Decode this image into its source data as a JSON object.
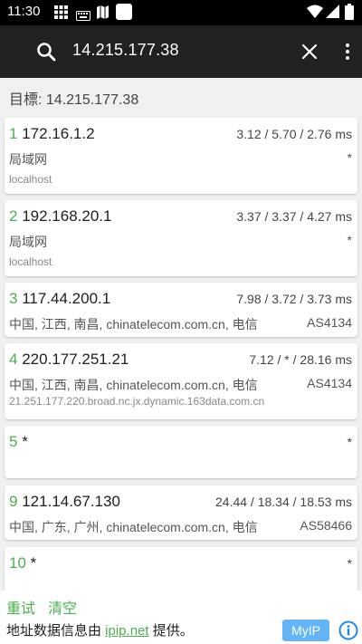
{
  "status": {
    "time": "11:30"
  },
  "search": {
    "query": "14.215.177.38"
  },
  "target": "目標: 14.215.177.38",
  "hops": [
    {
      "n": "1",
      "ip": "172.16.1.2",
      "times": "3.12 / 5.70 / 2.76 ms",
      "location": "局域网",
      "asn": "*",
      "host": "localhost"
    },
    {
      "n": "2",
      "ip": "192.168.20.1",
      "times": "3.37 / 3.37 / 4.27 ms",
      "location": "局域网",
      "asn": "*",
      "host": "localhost"
    },
    {
      "n": "3",
      "ip": "117.44.200.1",
      "times": "7.98 / 3.72 / 3.73 ms",
      "location": "中国, 江西, 南昌, chinatelecom.com.cn, 电信",
      "asn": "AS4134",
      "host": ""
    },
    {
      "n": "4",
      "ip": "220.177.251.21",
      "times": "7.12 / * / 28.16 ms",
      "location": "中国, 江西, 南昌, chinatelecom.com.cn, 电信",
      "asn": "AS4134",
      "host": "21.251.177.220.broad.nc.jx.dynamic.163data.com.cn"
    },
    {
      "n": "5",
      "ip": "*",
      "times": "*",
      "location": "",
      "asn": "",
      "host": ""
    },
    {
      "n": "9",
      "ip": "121.14.67.130",
      "times": "24.44 / 18.34 / 18.53 ms",
      "location": "中国, 广东, 广州, chinatelecom.com.cn, 电信",
      "asn": "AS58466",
      "host": ""
    },
    {
      "n": "10",
      "ip": "*",
      "times": "*",
      "location": "",
      "asn": "",
      "host": ""
    }
  ],
  "bottom": {
    "retry": "重试",
    "clear": "清空",
    "credit_prefix": "地址数据信息由 ",
    "credit_link": "ipip.net",
    "credit_suffix": " 提供。",
    "myip": "MyIP"
  }
}
